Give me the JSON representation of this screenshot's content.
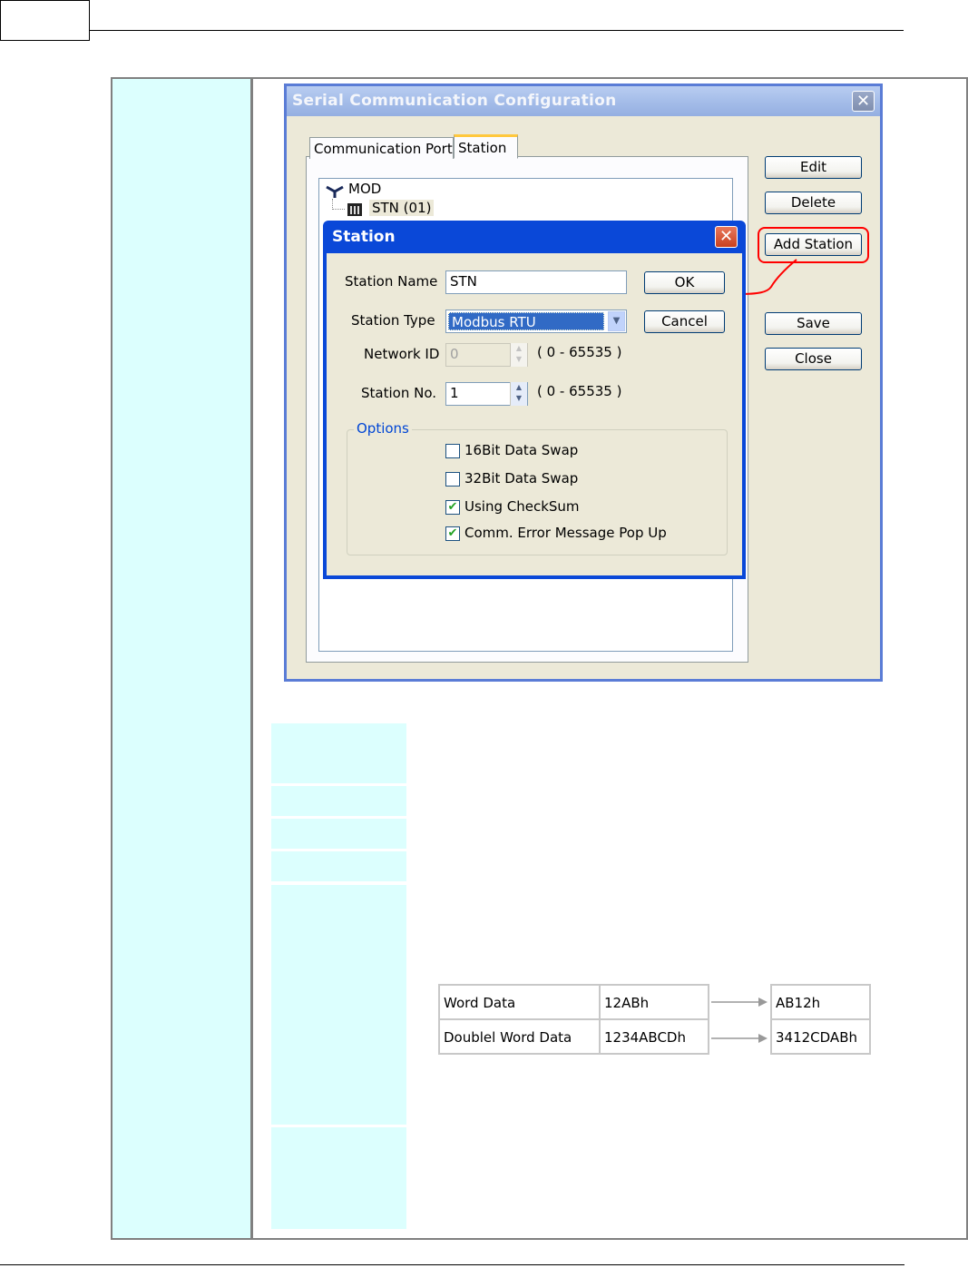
{
  "main_dialog": {
    "title": "Serial Communication Configuration",
    "close_glyph": "✕",
    "tabs": [
      "Communication Port",
      "Station"
    ],
    "active_tab": "Station",
    "tree": {
      "root": "MOD",
      "child": "STN (01)"
    },
    "buttons": {
      "edit": "Edit",
      "delete": "Delete",
      "add_station": "Add Station",
      "save": "Save",
      "close": "Close"
    }
  },
  "station_dialog": {
    "title": "Station",
    "close_glyph": "✕",
    "fields": {
      "station_name_label": "Station Name",
      "station_name_value": "STN",
      "station_type_label": "Station Type",
      "station_type_value": "Modbus RTU",
      "network_id_label": "Network ID",
      "network_id_value": "0",
      "network_id_range": "( 0 - 65535 )",
      "station_no_label": "Station No.",
      "station_no_value": "1",
      "station_no_range": "( 0 - 65535 )"
    },
    "buttons": {
      "ok": "OK",
      "cancel": "Cancel"
    },
    "options": {
      "title": "Options",
      "items": [
        {
          "label": "16Bit Data Swap",
          "checked": false
        },
        {
          "label": "32Bit Data Swap",
          "checked": false
        },
        {
          "label": "Using CheckSum",
          "checked": true
        },
        {
          "label": "Comm. Error Message Pop Up",
          "checked": true
        }
      ]
    }
  },
  "swap_table": {
    "rows": [
      {
        "label": "Word Data",
        "before": "12ABh",
        "after": "AB12h"
      },
      {
        "label": "Doublel Word Data",
        "before": "1234ABCDh",
        "after": "3412CDABh"
      }
    ]
  },
  "colors": {
    "left_column_bg": "#dcfffe",
    "highlight_red": "#ff0000",
    "xp_blue": "#0a48d8"
  }
}
